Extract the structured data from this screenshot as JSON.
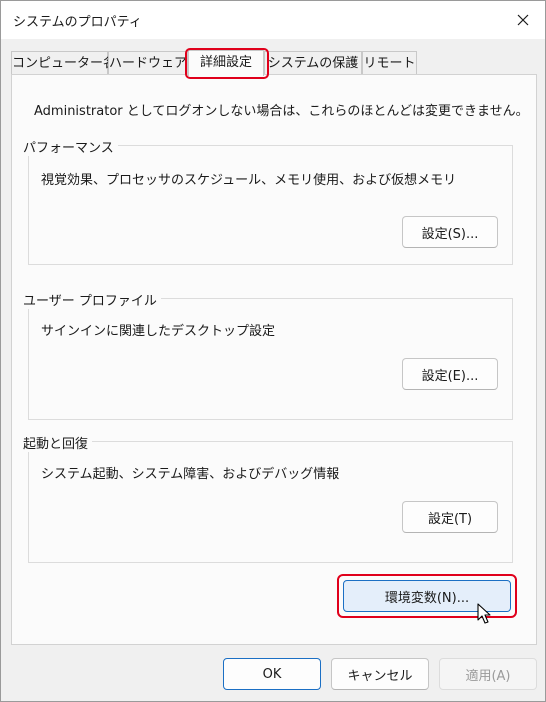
{
  "window": {
    "title": "システムのプロパティ"
  },
  "tabs": [
    {
      "label": "コンピューター名",
      "active": false
    },
    {
      "label": "ハードウェア",
      "active": false
    },
    {
      "label": "詳細設定",
      "active": true
    },
    {
      "label": "システムの保護",
      "active": false
    },
    {
      "label": "リモート",
      "active": false
    }
  ],
  "main": {
    "intro": "Administrator としてログオンしない場合は、これらのほとんどは変更できません。",
    "performance": {
      "title": "パフォーマンス",
      "description": "視覚効果、プロセッサのスケジュール、メモリ使用、および仮想メモリ",
      "button": "設定(S)..."
    },
    "user_profiles": {
      "title": "ユーザー プロファイル",
      "description": "サインインに関連したデスクトップ設定",
      "button": "設定(E)..."
    },
    "startup_recovery": {
      "title": "起動と回復",
      "description": "システム起動、システム障害、およびデバッグ情報",
      "button": "設定(T)"
    },
    "env_button": "環境変数(N)..."
  },
  "footer": {
    "ok": "OK",
    "cancel": "キャンセル",
    "apply": "適用(A)"
  },
  "colors": {
    "highlight": "#e0001b",
    "accent": "#1b6fc4"
  },
  "icons": {
    "close": "close-icon",
    "cursor": "mouse-pointer-icon"
  }
}
